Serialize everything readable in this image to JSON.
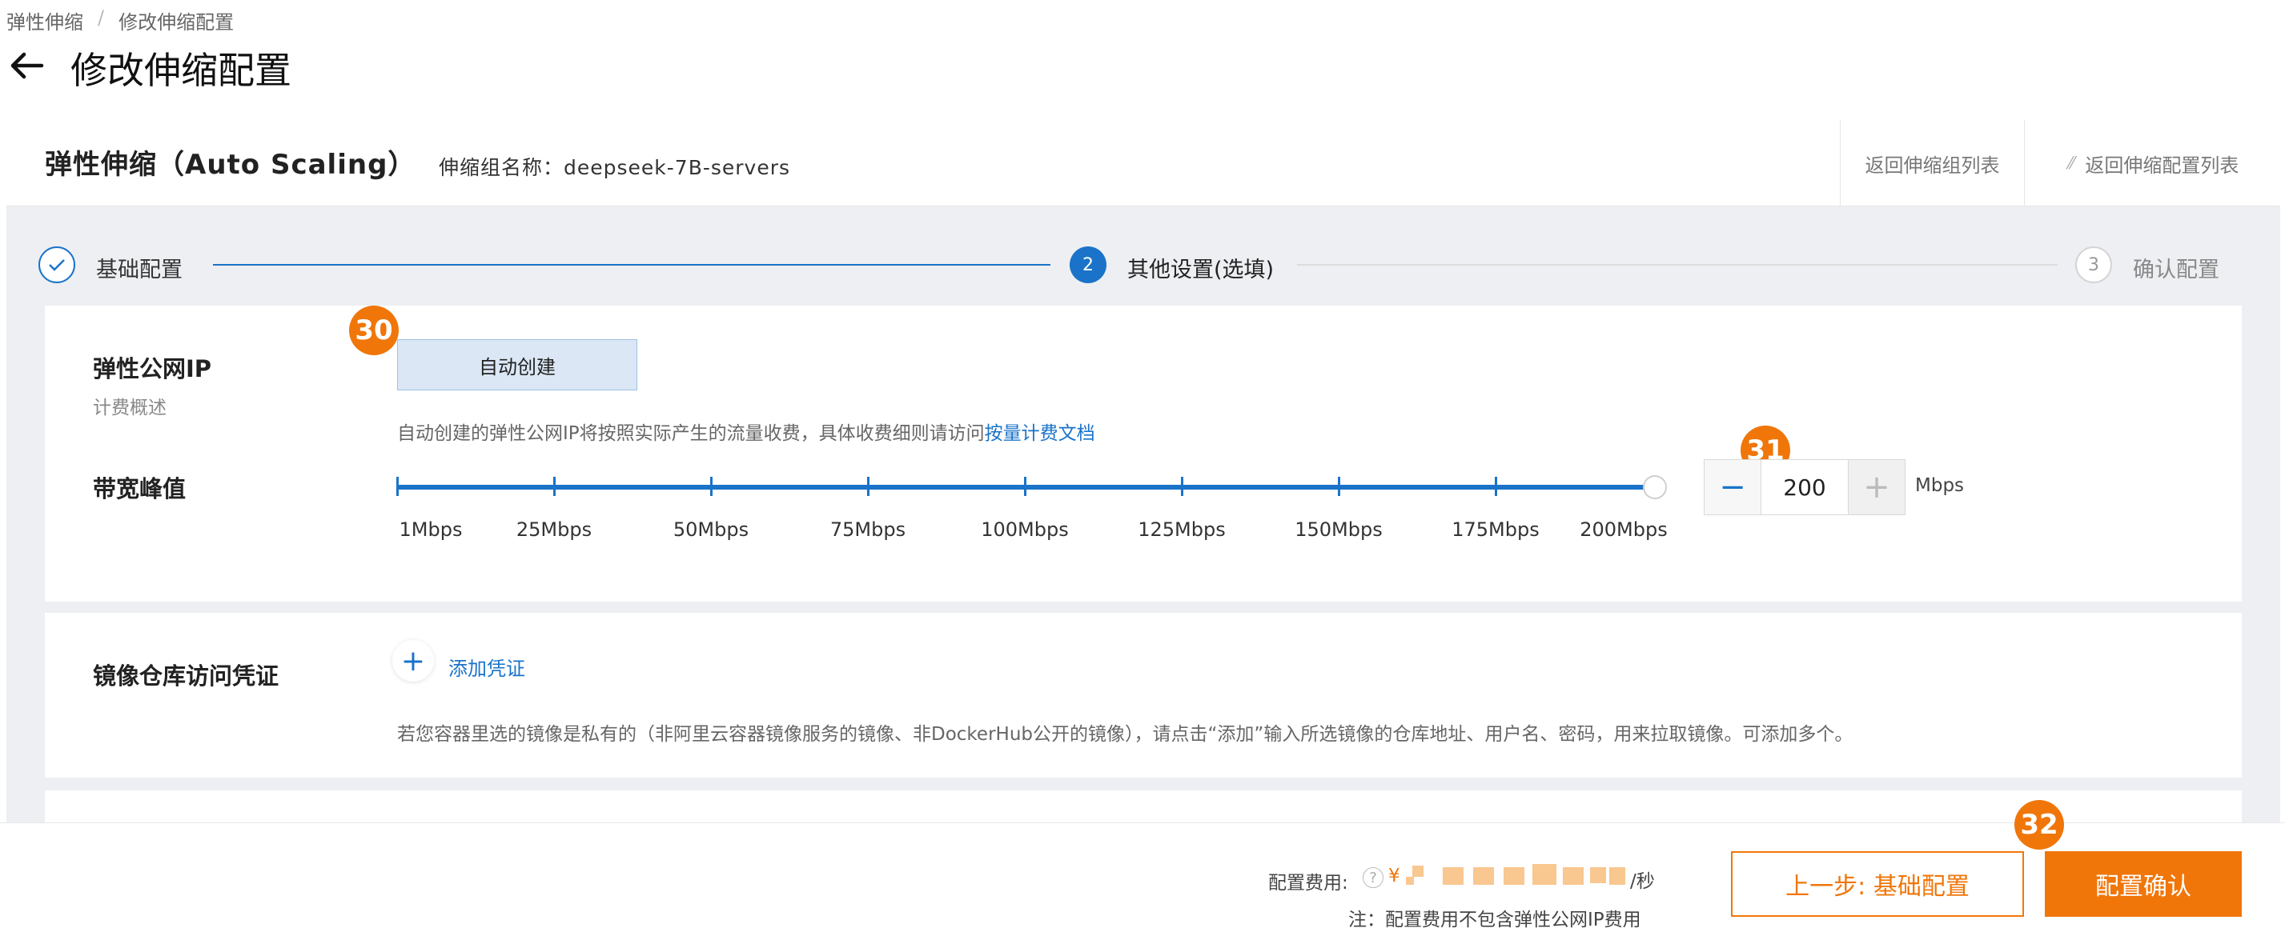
{
  "breadcrumb": {
    "parent": "弹性伸缩",
    "separator": "/",
    "current": "修改伸缩配置"
  },
  "page": {
    "title": "修改伸缩配置"
  },
  "header": {
    "product_title": "弹性伸缩（Auto Scaling）",
    "group_label": "伸缩组名称：deepseek-7B-servers",
    "link_back_groups": "返回伸缩组列表",
    "link_back_configs": "返回伸缩配置列表"
  },
  "steps": [
    {
      "label": "基础配置",
      "number": "1",
      "state": "done"
    },
    {
      "label": "其他设置(选填)",
      "number": "2",
      "state": "active"
    },
    {
      "label": "确认配置",
      "number": "3",
      "state": "todo"
    }
  ],
  "eip": {
    "label": "弹性公网IP",
    "sublabel": "计费概述",
    "auto_create_button": "自动创建",
    "hint_text": "自动创建的弹性公网IP将按照实际产生的流量收费，具体收费细则请访问",
    "hint_link": "按量计费文档"
  },
  "bandwidth": {
    "label": "带宽峰值",
    "ticks": [
      "1Mbps",
      "25Mbps",
      "50Mbps",
      "75Mbps",
      "100Mbps",
      "125Mbps",
      "150Mbps",
      "175Mbps",
      "200Mbps"
    ],
    "min": 1,
    "max": 200,
    "value": "200",
    "unit": "Mbps",
    "minus": "−",
    "plus": "+"
  },
  "registry": {
    "label": "镜像仓库访问凭证",
    "add_icon": "+",
    "add_label": "添加凭证",
    "note": "若您容器里选的镜像是私有的（非阿里云容器镜像服务的镜像、非DockerHub公开的镜像），请点击“添加”输入所选镜像的仓库地址、用户名、密码，用来拉取镜像。可添加多个。"
  },
  "markers": [
    "30",
    "31",
    "32"
  ],
  "footer": {
    "cost_label": "配置费用:",
    "help_icon": "?",
    "currency": "¥",
    "per_unit": "/秒",
    "note": "注：配置费用不包含弹性公网IP费用",
    "prev_button": "上一步: 基础配置",
    "confirm_button": "配置确认"
  },
  "colors": {
    "accent": "#1a73c9",
    "brand_orange": "#f0760a",
    "background_grey": "#edeff2"
  }
}
